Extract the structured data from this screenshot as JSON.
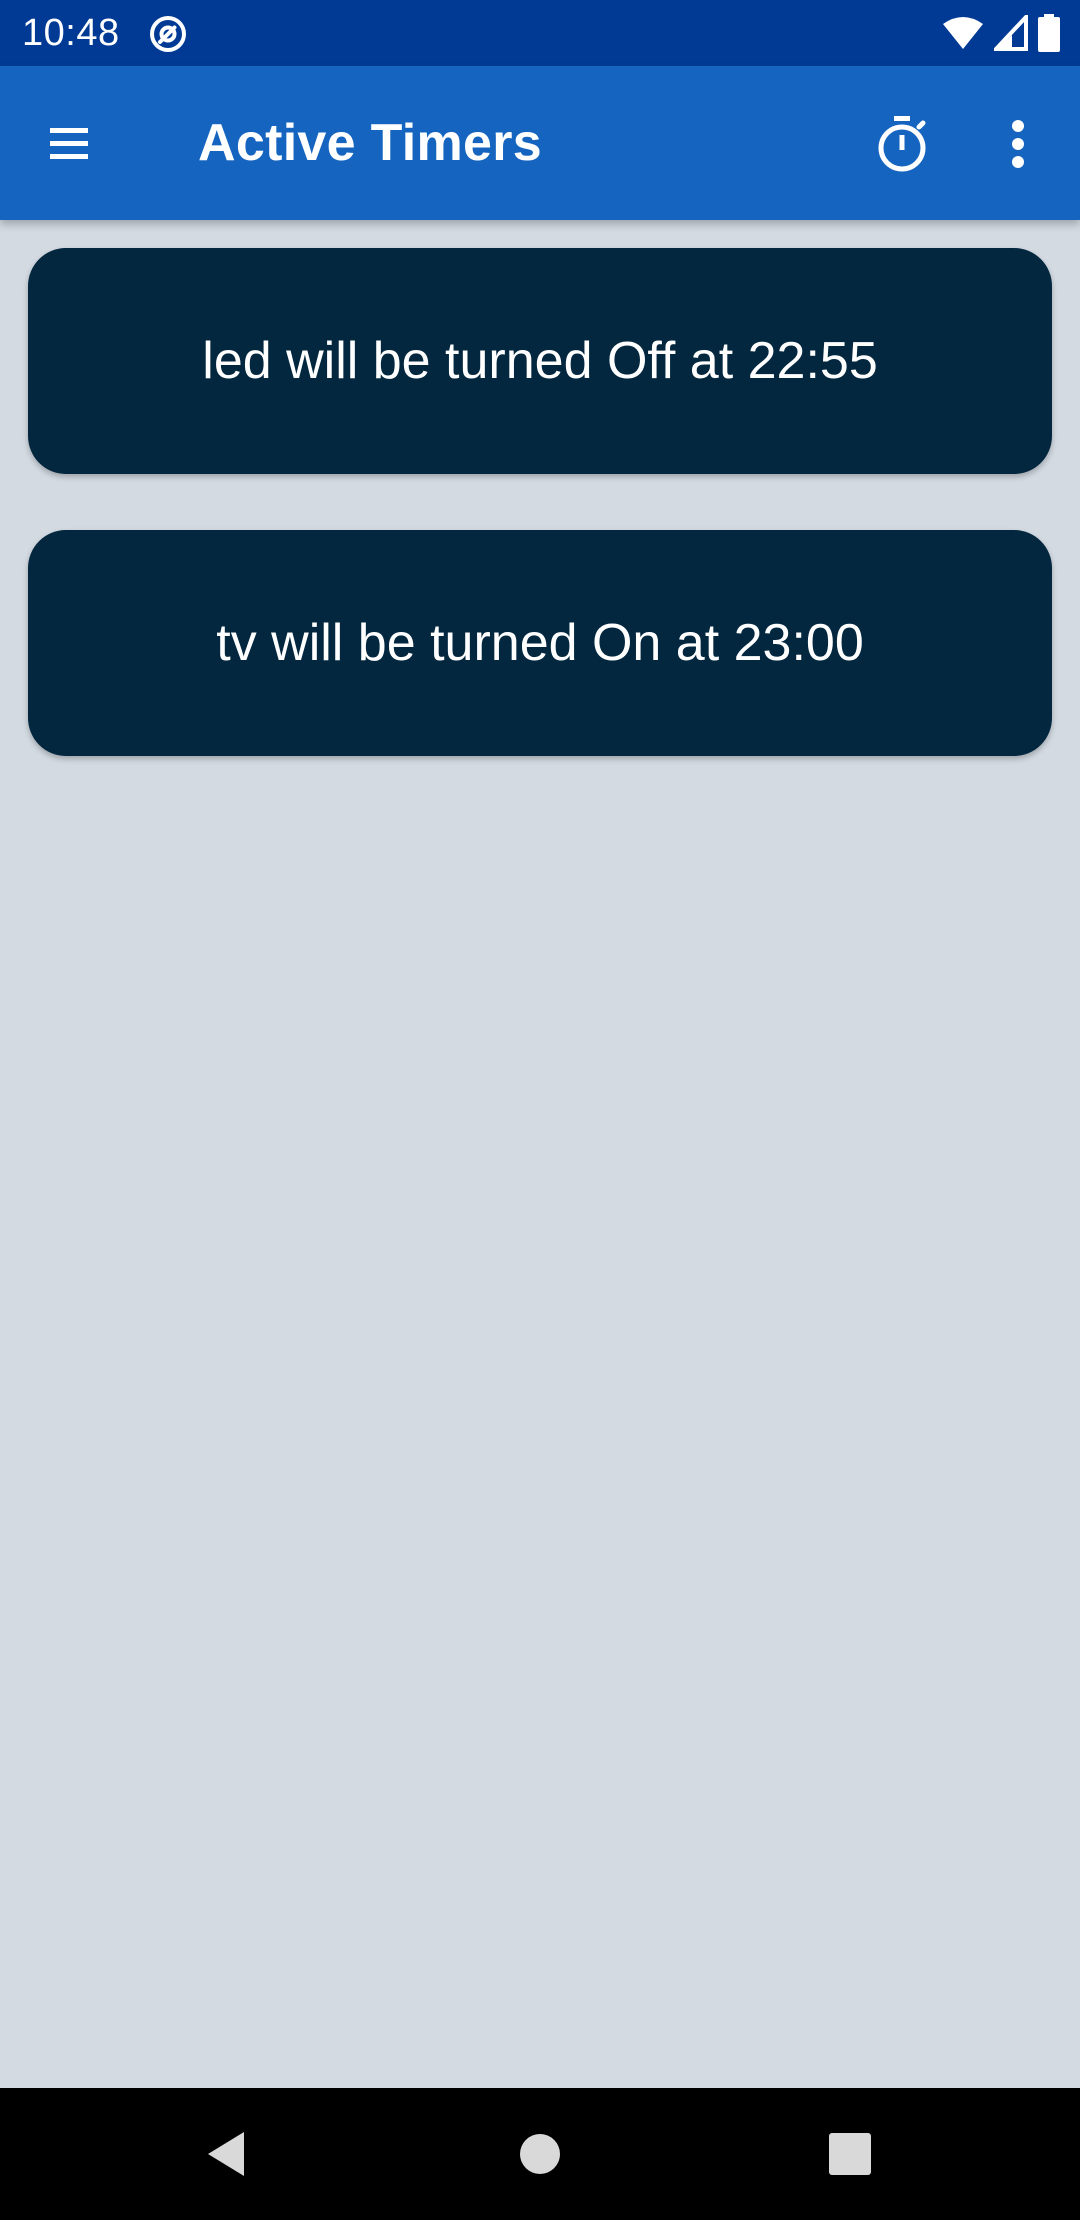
{
  "status_bar": {
    "time": "10:48",
    "icons": [
      "notification-at-icon",
      "wifi-icon",
      "signal-icon",
      "battery-icon"
    ]
  },
  "app_bar": {
    "title": "Active Timers",
    "menu_icon": "hamburger-menu-icon",
    "actions": [
      "stopwatch-icon",
      "more-vert-icon"
    ]
  },
  "timers": [
    {
      "text": "led will be turned Off at 22:55"
    },
    {
      "text": "tv will be turned On at 23:00"
    }
  ],
  "nav_bar": {
    "buttons": [
      "back-icon",
      "home-icon",
      "recents-icon"
    ]
  },
  "colors": {
    "status_bar": "#013a94",
    "app_bar": "#1565c0",
    "background": "#d3dae2",
    "card": "#02273f",
    "text_on_dark": "#ffffff"
  }
}
